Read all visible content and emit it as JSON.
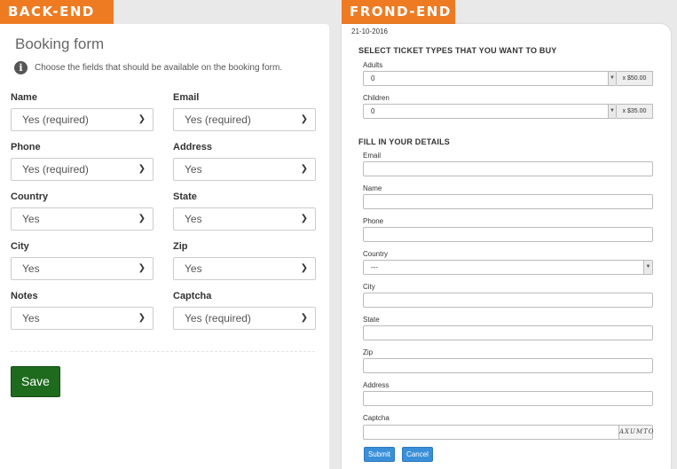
{
  "tabs": {
    "back": "BACK-END",
    "front": "FROND-END"
  },
  "back": {
    "title": "Booking form",
    "help": "Choose the fields that should be available on the booking form.",
    "fields": [
      {
        "label": "Name",
        "value": "Yes (required)"
      },
      {
        "label": "Email",
        "value": "Yes (required)"
      },
      {
        "label": "Phone",
        "value": "Yes (required)"
      },
      {
        "label": "Address",
        "value": "Yes"
      },
      {
        "label": "Country",
        "value": "Yes"
      },
      {
        "label": "State",
        "value": "Yes"
      },
      {
        "label": "City",
        "value": "Yes"
      },
      {
        "label": "Zip",
        "value": "Yes"
      },
      {
        "label": "Notes",
        "value": "Yes"
      },
      {
        "label": "Captcha",
        "value": "Yes (required)"
      }
    ],
    "save": "Save"
  },
  "front": {
    "date": "21-10-2016",
    "tickets_heading": "SELECT TICKET TYPES THAT YOU WANT TO BUY",
    "tickets": [
      {
        "label": "Adults",
        "value": "0",
        "price": "x $50.00"
      },
      {
        "label": "Children",
        "value": "0",
        "price": "x $35.00"
      }
    ],
    "details_heading": "FILL IN YOUR DETAILS",
    "details": {
      "email": "Email",
      "name": "Name",
      "phone": "Phone",
      "country": "Country",
      "country_value": "---",
      "city": "City",
      "state": "State",
      "zip": "Zip",
      "address": "Address",
      "captcha": "Captcha",
      "captcha_text": "AXUMTO"
    },
    "submit": "Submit",
    "cancel": "Cancel"
  }
}
